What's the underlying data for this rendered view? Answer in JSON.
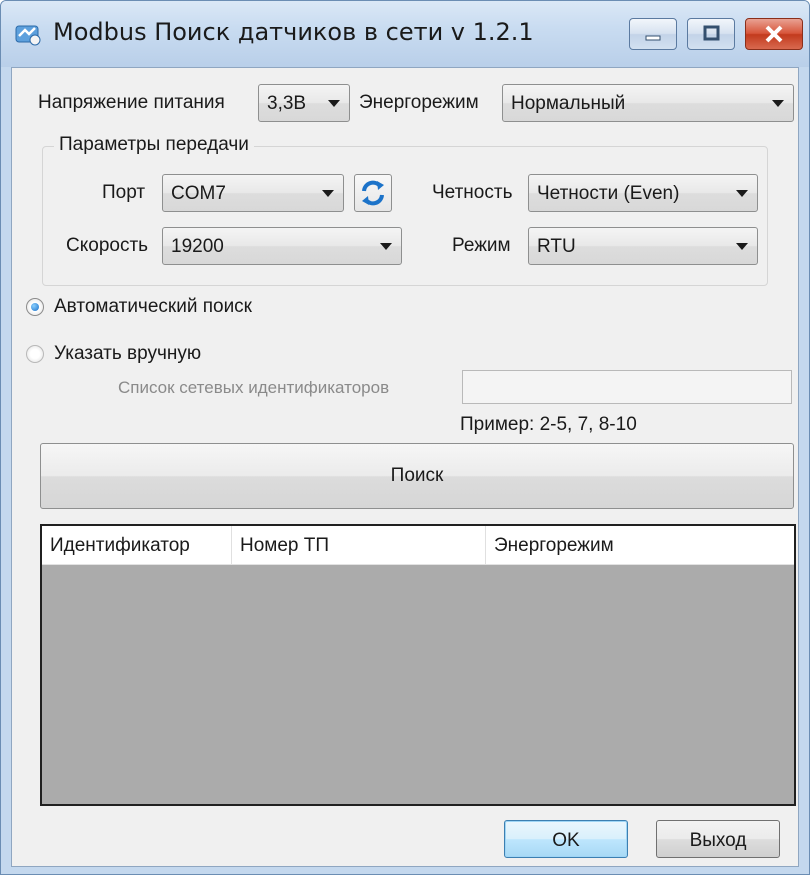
{
  "window": {
    "title": "Modbus Поиск датчиков в сети v 1.2.1"
  },
  "supply": {
    "label": "Напряжение питания",
    "value": "3,3В"
  },
  "power_mode": {
    "label": "Энергорежим",
    "value": "Нормальный"
  },
  "transfer": {
    "group_title": "Параметры передачи",
    "port_label": "Порт",
    "port_value": "COM7",
    "parity_label": "Четность",
    "parity_value": "Четности (Even)",
    "speed_label": "Скорость",
    "speed_value": "19200",
    "mode_label": "Режим",
    "mode_value": "RTU"
  },
  "search_options": {
    "auto_label": "Автоматический поиск",
    "auto_selected": true,
    "manual_label": "Указать вручную",
    "manual_selected": false,
    "id_list_label": "Список сетевых идентификаторов",
    "id_list_value": "",
    "example": "Пример: 2-5, 7, 8-10"
  },
  "search_button": "Поиск",
  "results": {
    "columns": [
      "Идентификатор",
      "Номер ТП",
      "Энергорежим"
    ],
    "rows": []
  },
  "footer": {
    "ok": "OK",
    "exit": "Выход"
  },
  "icons": [
    "app-icon",
    "minimize-icon",
    "maximize-icon",
    "close-icon",
    "refresh-icon",
    "chevron-down-icon"
  ]
}
